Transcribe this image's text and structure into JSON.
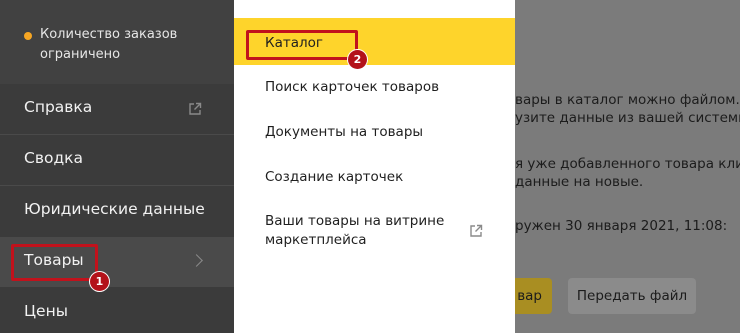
{
  "sidebar": {
    "notice": "Количество заказов ограничено",
    "items": [
      {
        "label": "Справка"
      },
      {
        "label": "Сводка"
      },
      {
        "label": "Юридические данные"
      },
      {
        "label": "Товары"
      },
      {
        "label": "Цены"
      }
    ]
  },
  "menu": {
    "items": [
      {
        "label": "Каталог"
      },
      {
        "label": "Поиск карточек товаров"
      },
      {
        "label": "Документы на товары"
      },
      {
        "label": "Создание карточек"
      },
      {
        "label": "Ваши товары на витрине маркетплейса"
      }
    ]
  },
  "content": {
    "line1": "вары в каталог можно файлом. Для",
    "line2": "узите данные из вашей системы в ф",
    "line3": "я уже добавленного товара кликни",
    "line4": "данные на новые.",
    "line5": "ружен 30 января 2021, 11:08:",
    "btn_primary": "вар",
    "btn_secondary": "Передать файл"
  },
  "annotations": {
    "badge1": "1",
    "badge2": "2"
  },
  "colors": {
    "sidebar_bg": "#3b3b3b",
    "active_menu": "#fed42b",
    "callout": "#c1121c",
    "notice_dot": "#f6a623"
  }
}
